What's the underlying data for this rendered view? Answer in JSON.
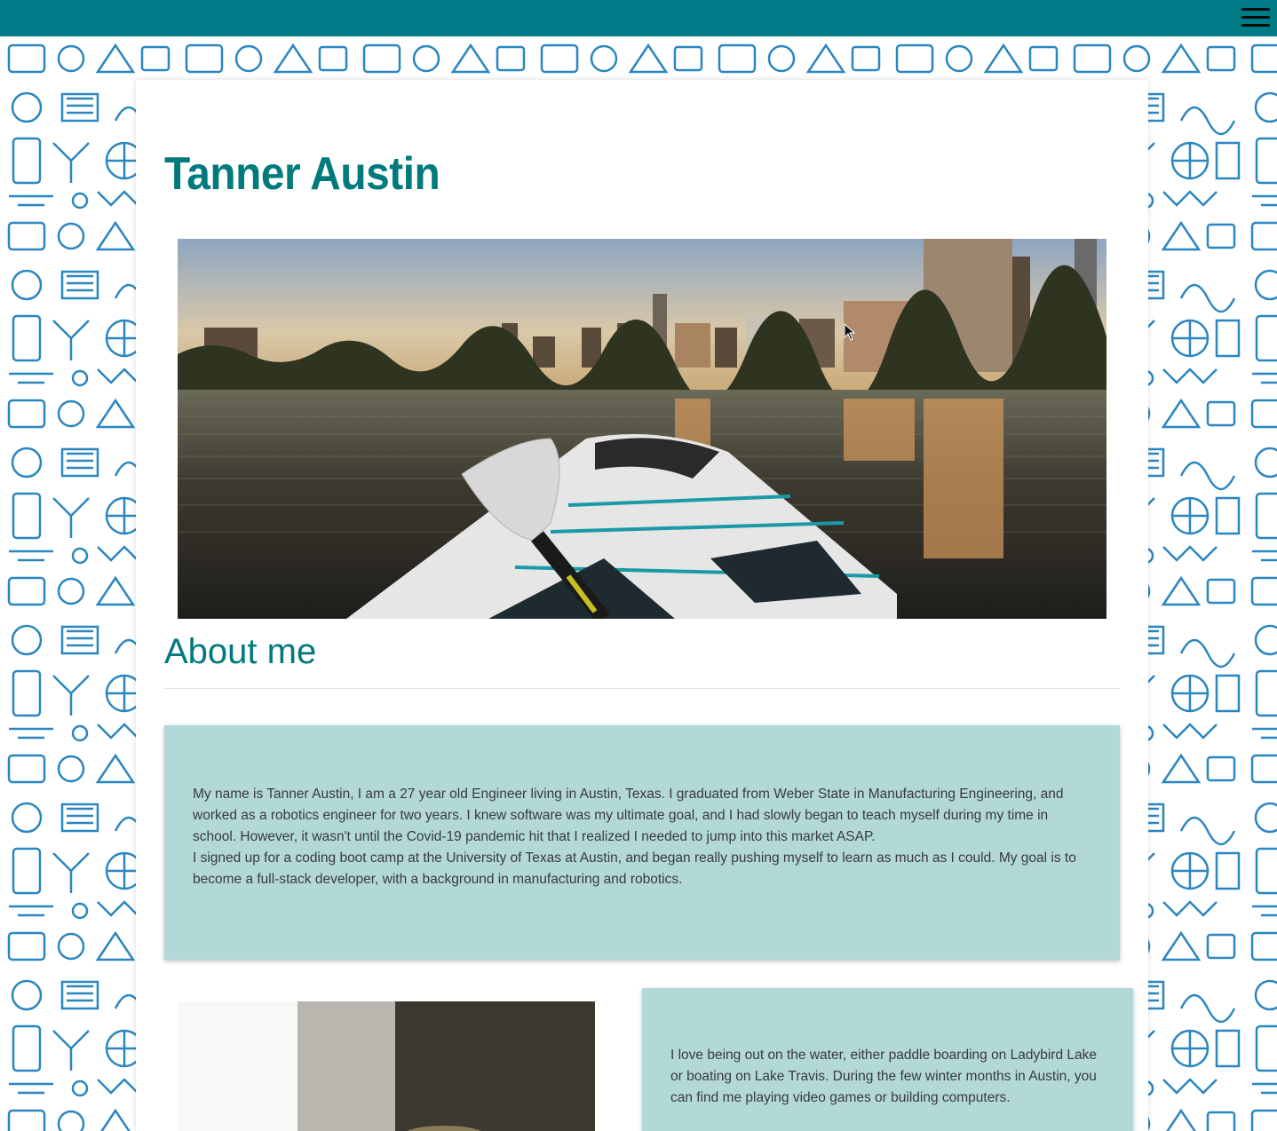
{
  "nav": {
    "menu_icon": "hamburger-menu-icon"
  },
  "header": {
    "name": "Tanner Austin"
  },
  "hero": {
    "image": "austin-skyline-paddleboard-photo"
  },
  "about": {
    "heading": "About me",
    "paragraph_1": "My name is Tanner Austin, I am a 27 year old Engineer living in Austin, Texas. I graduated from Weber State in Manufacturing Engineering, and worked as a robotics engineer for two years. I knew software was my ultimate goal, and I had slowly began to teach myself during my time in school. However, it wasn't until the Covid-19 pandemic hit that I realized I needed to jump into this market ASAP.",
    "paragraph_2": "I signed up for a coding boot camp at the University of Texas at Austin, and began really pushing myself to learn as much as I could. My goal is to become a full-stack developer, with a background in manufacturing and robotics."
  },
  "hobbies": {
    "portrait_image": "portrait-photo",
    "text": "I love being out on the water, either paddle boarding on Ladybird Lake or boating on Lake Travis. During the few winter months in Austin, you can find me playing video games or building computers."
  },
  "colors": {
    "accent": "#007a87",
    "heading": "#007a7d",
    "card_bg": "#b2d8d8",
    "pattern": "#1e78aa"
  }
}
